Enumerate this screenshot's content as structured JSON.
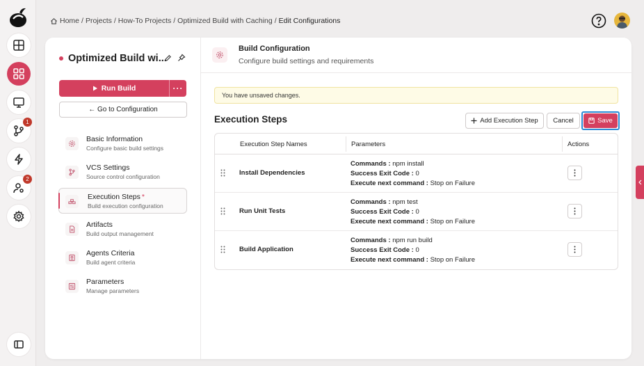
{
  "breadcrumb": {
    "items": [
      "Home",
      "Projects",
      "How-To Projects",
      "Optimized Build with Caching"
    ],
    "current": "Edit Configurations",
    "separator": "/"
  },
  "rail": {
    "badges": {
      "vcs": "1",
      "users": "2"
    }
  },
  "sidebar": {
    "build_title": "Optimized Build wi...",
    "run_label": "Run Build",
    "run_more": "···",
    "goto_label": "← Go to Configuration",
    "items": [
      {
        "label": "Basic Information",
        "sub": "Configure basic build settings",
        "icon": "gear-icon"
      },
      {
        "label": "VCS Settings",
        "sub": "Source control configuration",
        "icon": "branch-icon"
      },
      {
        "label": "Execution Steps",
        "sub": "Build execution configuration",
        "icon": "steps-icon",
        "required": "*"
      },
      {
        "label": "Artifacts",
        "sub": "Build output management",
        "icon": "file-icon"
      },
      {
        "label": "Agents Criteria",
        "sub": "Build agent criteria",
        "icon": "agent-icon"
      },
      {
        "label": "Parameters",
        "sub": "Manage parameters",
        "icon": "sliders-icon"
      }
    ]
  },
  "header": {
    "title": "Build Configuration",
    "subtitle": "Configure build settings and requirements"
  },
  "notice": "You have unsaved changes.",
  "section": {
    "title": "Execution Steps",
    "add_label": "Add Execution Step",
    "cancel_label": "Cancel",
    "save_label": "Save"
  },
  "table": {
    "columns": [
      "Execution Step Names",
      "Parameters",
      "Actions"
    ],
    "param_labels": {
      "commands": "Commands :",
      "exit": "Success Exit Code :",
      "next": "Execute next command :"
    },
    "rows": [
      {
        "name": "Install Dependencies",
        "commands": "npm install",
        "exit": "0",
        "next": "Stop on Failure"
      },
      {
        "name": "Run Unit Tests",
        "commands": "npm test",
        "exit": "0",
        "next": "Stop on Failure"
      },
      {
        "name": "Build Application",
        "commands": "npm run build",
        "exit": "0",
        "next": "Stop on Failure"
      }
    ]
  },
  "colors": {
    "accent": "#d4405e",
    "focus": "#2a8ad4",
    "notice_bg": "#fefbe6"
  }
}
